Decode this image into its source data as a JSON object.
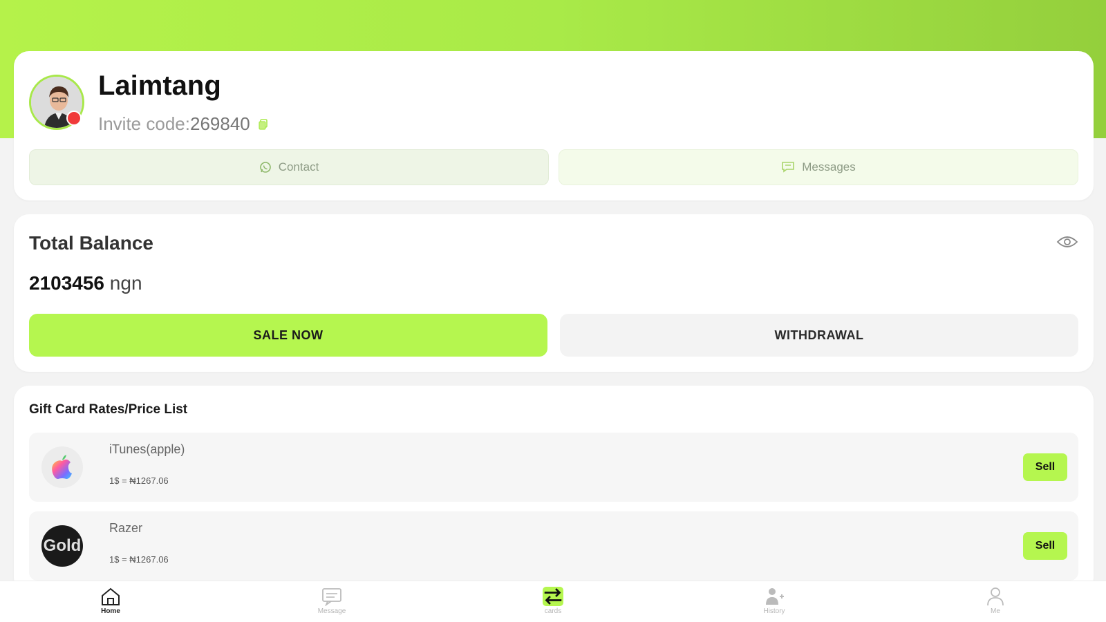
{
  "profile": {
    "name": "Laimtang",
    "invite_label": "Invite code:",
    "invite_code": "269840",
    "contact_label": "Contact",
    "messages_label": "Messages"
  },
  "balance": {
    "title": "Total Balance",
    "amount": "2103456",
    "currency": "ngn",
    "sale_label": "SALE NOW",
    "withdraw_label": "WITHDRAWAL"
  },
  "rates": {
    "title": "Gift Card Rates/Price List",
    "items": [
      {
        "name": "iTunes(apple)",
        "price": "1$ = ₦1267.06",
        "sell_label": "Sell",
        "icon": "apple-logo-icon"
      },
      {
        "name": "Razer",
        "price": "1$ = ₦1267.06",
        "sell_label": "Sell",
        "icon": "razer-gold-logo-icon",
        "logo_text": "Gold"
      }
    ]
  },
  "nav": {
    "items": [
      {
        "label": "Home",
        "icon": "home-icon",
        "active": true
      },
      {
        "label": "Message",
        "icon": "message-icon",
        "active": false
      },
      {
        "label": "cards",
        "icon": "swap-icon",
        "active": false
      },
      {
        "label": "History",
        "icon": "history-icon",
        "active": false
      },
      {
        "label": "Me",
        "icon": "user-icon",
        "active": false
      }
    ]
  },
  "colors": {
    "accent": "#b5f64f",
    "header_gradient_start": "#b5f24a",
    "header_gradient_end": "#94cf3c",
    "badge_red": "#f03a3a"
  }
}
